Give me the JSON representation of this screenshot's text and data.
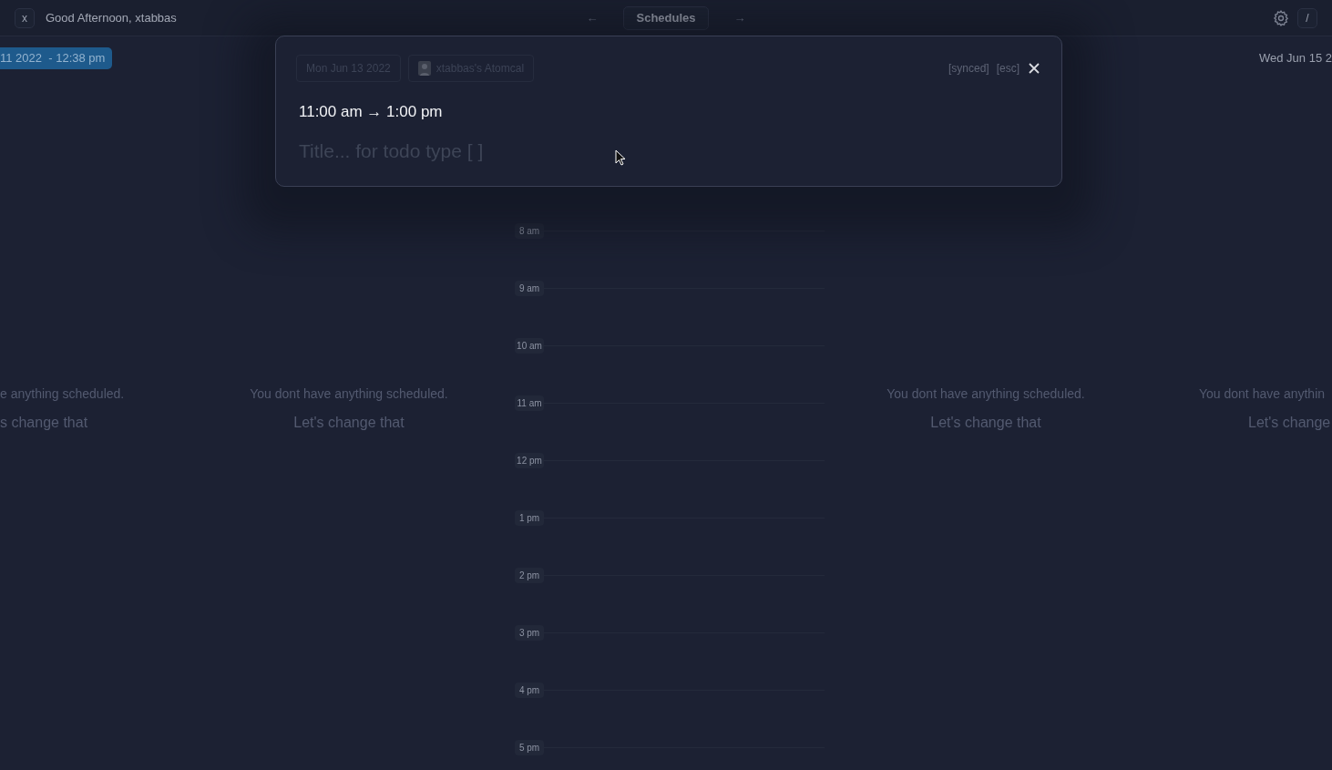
{
  "topbar": {
    "close_label": "x",
    "greeting": "Good Afternoon, xtabbas",
    "prev_label": "←",
    "nav_title": "Schedules",
    "next_label": "→",
    "shortcut_label": "/"
  },
  "days": [
    {
      "kind": "left-edge",
      "date_label": "11 2022  - 12:38 pm",
      "today": true,
      "empty_title": "e anything scheduled.",
      "empty_action": "s change that"
    },
    {
      "kind": "full",
      "empty_title": "You dont have anything scheduled.",
      "empty_action": "Let's change that"
    },
    {
      "kind": "timeline",
      "hours": [
        "8 am",
        "9 am",
        "10 am",
        "11 am",
        "12 pm",
        "1 pm",
        "2 pm",
        "3 pm",
        "4 pm",
        "5 pm"
      ]
    },
    {
      "kind": "full",
      "empty_title": "You dont have anything scheduled.",
      "empty_action": "Let's change that"
    },
    {
      "kind": "right-edge",
      "date_label": "Wed Jun 15 2",
      "today": false,
      "empty_title": "You dont have anythin",
      "empty_action": "Let's change"
    }
  ],
  "event_editor": {
    "date": "Mon Jun 13 2022",
    "calendar": "xtabbas's Atomcal",
    "sync_status": "[synced]",
    "esc_hint": "[esc]",
    "time_range": "11:00 am → 1:00 pm",
    "title_placeholder": "Title... for todo type [ ]"
  }
}
